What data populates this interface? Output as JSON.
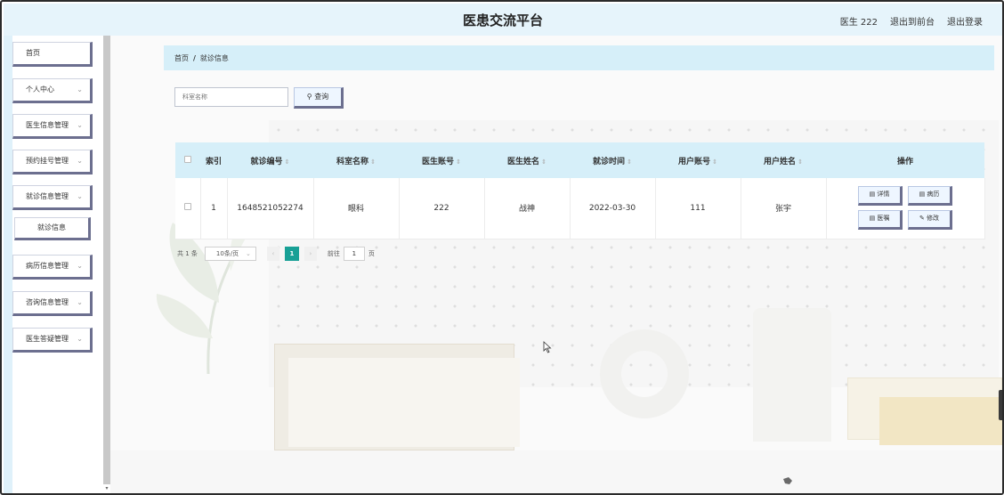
{
  "header": {
    "title": "医患交流平台",
    "user_label": "医生 222",
    "back_label": "退出到前台",
    "logout_label": "退出登录"
  },
  "sidebar": {
    "items": [
      {
        "label": "首页",
        "has_chevron": false
      },
      {
        "label": "个人中心",
        "has_chevron": true
      },
      {
        "label": "医生信息管理",
        "has_chevron": true
      },
      {
        "label": "预约挂号管理",
        "has_chevron": true
      },
      {
        "label": "就诊信息管理",
        "has_chevron": true,
        "expanded": true
      },
      {
        "label": "病历信息管理",
        "has_chevron": true
      },
      {
        "label": "咨询信息管理",
        "has_chevron": true
      },
      {
        "label": "医生答疑管理",
        "has_chevron": true
      }
    ],
    "sub_item": {
      "label": "就诊信息"
    },
    "chevron_char": "⌄"
  },
  "breadcrumb": {
    "home": "首页",
    "separator": "/",
    "current": "就诊信息"
  },
  "search": {
    "placeholder": "科室名称",
    "button_label": "查询",
    "button_icon": "search-icon"
  },
  "table": {
    "columns": [
      "",
      "索引",
      "就诊编号",
      "科室名称",
      "医生账号",
      "医生姓名",
      "就诊时间",
      "用户账号",
      "用户姓名",
      "操作"
    ],
    "sortable": [
      false,
      false,
      true,
      true,
      true,
      true,
      true,
      true,
      true,
      false
    ],
    "rows": [
      {
        "index": "1",
        "visit_no": "1648521052274",
        "dept": "眼科",
        "doctor_account": "222",
        "doctor_name": "战神",
        "visit_time": "2022-03-30",
        "user_account": "111",
        "user_name": "张宇"
      }
    ],
    "actions": [
      {
        "label": "详情",
        "icon": "document-icon"
      },
      {
        "label": "病历",
        "icon": "document-icon"
      },
      {
        "label": "医嘱",
        "icon": "document-icon"
      },
      {
        "label": "修改",
        "icon": "pencil-icon"
      }
    ]
  },
  "pagination": {
    "total": "共 1 条",
    "page_size": "10条/页",
    "current_page": "1",
    "goto_label": "前往",
    "goto_value": "1",
    "page_unit": "页"
  },
  "colors": {
    "header_bg": "#e6f4fb",
    "table_header_bg": "#d6eff9",
    "active_page": "#18a096",
    "button_shadow": "#6c6f8f"
  }
}
